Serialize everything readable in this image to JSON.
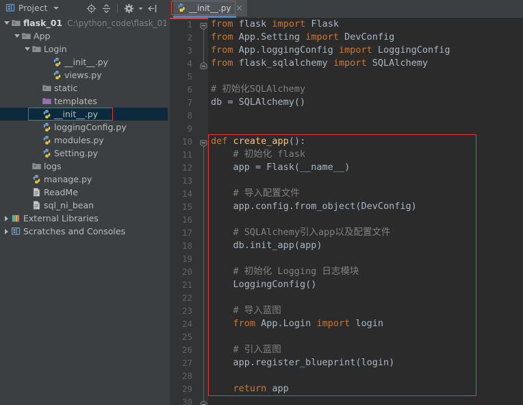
{
  "window": {
    "background": "#3c3f41",
    "editor_background": "#2b2b2b",
    "accent": "#4a88c7",
    "highlight_box_color": "#e83b2f",
    "selection_color": "#0d293e"
  },
  "toolbar": {
    "project_label": "Project",
    "project_icon": "project-panel-icon",
    "dropdown_icon": "chevron-down-icon",
    "buttons": [
      {
        "name": "locate-in-tree-icon",
        "title": "Select Opened File"
      },
      {
        "name": "collapse-all-icon",
        "title": "Collapse All"
      },
      {
        "name": "settings-gear-icon",
        "title": "Settings"
      },
      {
        "name": "hide-panel-icon",
        "title": "Hide"
      }
    ]
  },
  "tabs": [
    {
      "label": "__init__.py",
      "icon": "python-file-icon",
      "close_icon": "close-icon",
      "active": true,
      "highlighted": true
    }
  ],
  "sidebar": {
    "items": [
      {
        "indent": 0,
        "arrow": "down",
        "icon": "folder-module-icon",
        "label": "flask_01",
        "path": "C:\\python_code\\flask_01",
        "bold": true,
        "selected": false
      },
      {
        "indent": 1,
        "arrow": "down",
        "icon": "folder-source-icon",
        "label": "App",
        "path": "",
        "bold": false,
        "selected": false
      },
      {
        "indent": 2,
        "arrow": "down",
        "icon": "folder-source-icon",
        "label": "Login",
        "path": "",
        "bold": false,
        "selected": false
      },
      {
        "indent": 4,
        "arrow": "none",
        "icon": "python-file-icon",
        "label": "__init__.py",
        "path": "",
        "bold": false,
        "selected": false
      },
      {
        "indent": 4,
        "arrow": "none",
        "icon": "python-file-icon",
        "label": "views.py",
        "path": "",
        "bold": false,
        "selected": false
      },
      {
        "indent": 3,
        "arrow": "none",
        "icon": "folder-source-icon",
        "label": "static",
        "path": "",
        "bold": false,
        "selected": false
      },
      {
        "indent": 3,
        "arrow": "none",
        "icon": "folder-template-icon",
        "label": "templates",
        "path": "",
        "bold": false,
        "selected": false
      },
      {
        "indent": 3,
        "arrow": "none",
        "icon": "python-file-icon",
        "label": "__init__.py",
        "path": "",
        "bold": false,
        "selected": true
      },
      {
        "indent": 3,
        "arrow": "none",
        "icon": "python-file-icon",
        "label": "loggingConfig.py",
        "path": "",
        "bold": false,
        "selected": false
      },
      {
        "indent": 3,
        "arrow": "none",
        "icon": "python-file-icon",
        "label": "modules.py",
        "path": "",
        "bold": false,
        "selected": false
      },
      {
        "indent": 3,
        "arrow": "none",
        "icon": "python-file-icon",
        "label": "Setting.py",
        "path": "",
        "bold": false,
        "selected": false
      },
      {
        "indent": 2,
        "arrow": "none",
        "icon": "folder-source-icon",
        "label": "logs",
        "path": "",
        "bold": false,
        "selected": false
      },
      {
        "indent": 2,
        "arrow": "none",
        "icon": "python-file-icon",
        "label": "manage.py",
        "path": "",
        "bold": false,
        "selected": false
      },
      {
        "indent": 2,
        "arrow": "none",
        "icon": "text-file-icon",
        "label": "ReadMe",
        "path": "",
        "bold": false,
        "selected": false
      },
      {
        "indent": 2,
        "arrow": "none",
        "icon": "text-file-icon",
        "label": "sql_ni_bean",
        "path": "",
        "bold": false,
        "selected": false
      },
      {
        "indent": 0,
        "arrow": "right",
        "icon": "external-libraries-icon",
        "label": "External Libraries",
        "path": "",
        "bold": false,
        "selected": false
      },
      {
        "indent": 0,
        "arrow": "right",
        "icon": "scratches-icon",
        "label": "Scratches and Consoles",
        "path": "",
        "bold": false,
        "selected": false
      }
    ]
  },
  "editor": {
    "filename": "__init__.py",
    "first_line": 1,
    "last_line": 30,
    "fold_markers": [
      {
        "line": 1,
        "type": "fold-start"
      },
      {
        "line": 4,
        "type": "fold-end"
      },
      {
        "line": 10,
        "type": "fold-start"
      },
      {
        "line": 29,
        "type": "fold-end"
      }
    ],
    "lines": [
      {
        "n": 1,
        "tokens": [
          {
            "t": "from",
            "c": "kw"
          },
          {
            "t": " flask ",
            "c": "id"
          },
          {
            "t": "import",
            "c": "kw"
          },
          {
            "t": " Flask",
            "c": "id"
          }
        ]
      },
      {
        "n": 2,
        "tokens": [
          {
            "t": "from",
            "c": "kw"
          },
          {
            "t": " App.Setting ",
            "c": "id"
          },
          {
            "t": "import",
            "c": "kw"
          },
          {
            "t": " DevConfig",
            "c": "id"
          }
        ]
      },
      {
        "n": 3,
        "tokens": [
          {
            "t": "from",
            "c": "kw"
          },
          {
            "t": " App.loggingConfig ",
            "c": "id"
          },
          {
            "t": "import",
            "c": "kw"
          },
          {
            "t": " LoggingConfig",
            "c": "id"
          }
        ]
      },
      {
        "n": 4,
        "tokens": [
          {
            "t": "from",
            "c": "kw"
          },
          {
            "t": " flask_sqlalchemy ",
            "c": "id"
          },
          {
            "t": "import",
            "c": "kw"
          },
          {
            "t": " SQLAlchemy",
            "c": "id"
          }
        ]
      },
      {
        "n": 5,
        "tokens": []
      },
      {
        "n": 6,
        "tokens": [
          {
            "t": "# 初始化SQLAlchemy",
            "c": "cm"
          }
        ]
      },
      {
        "n": 7,
        "tokens": [
          {
            "t": "db = SQLAlchemy()",
            "c": "id"
          }
        ]
      },
      {
        "n": 8,
        "tokens": []
      },
      {
        "n": 9,
        "tokens": []
      },
      {
        "n": 10,
        "tokens": [
          {
            "t": "def",
            "c": "kw"
          },
          {
            "t": " ",
            "c": "id"
          },
          {
            "t": "create_app",
            "c": "fn"
          },
          {
            "t": "():",
            "c": "id"
          }
        ]
      },
      {
        "n": 11,
        "tokens": [
          {
            "t": "    # 初始化 flask",
            "c": "cm"
          }
        ]
      },
      {
        "n": 12,
        "tokens": [
          {
            "t": "    app = Flask(__name__)",
            "c": "id"
          }
        ]
      },
      {
        "n": 13,
        "tokens": []
      },
      {
        "n": 14,
        "tokens": [
          {
            "t": "    # 导入配置文件",
            "c": "cm"
          }
        ]
      },
      {
        "n": 15,
        "tokens": [
          {
            "t": "    app.config.from_object(DevConfig)",
            "c": "id"
          }
        ]
      },
      {
        "n": 16,
        "tokens": []
      },
      {
        "n": 17,
        "tokens": [
          {
            "t": "    # SQLAlchemy引入app以及配置文件",
            "c": "cm"
          }
        ]
      },
      {
        "n": 18,
        "tokens": [
          {
            "t": "    db.init_app(app)",
            "c": "id"
          }
        ]
      },
      {
        "n": 19,
        "tokens": []
      },
      {
        "n": 20,
        "tokens": [
          {
            "t": "    # 初始化 Logging 日志模块",
            "c": "cm"
          }
        ]
      },
      {
        "n": 21,
        "tokens": [
          {
            "t": "    LoggingConfig()",
            "c": "id"
          }
        ]
      },
      {
        "n": 22,
        "tokens": []
      },
      {
        "n": 23,
        "tokens": [
          {
            "t": "    # 导入蓝图",
            "c": "cm"
          }
        ]
      },
      {
        "n": 24,
        "tokens": [
          {
            "t": "    ",
            "c": "id"
          },
          {
            "t": "from",
            "c": "kw"
          },
          {
            "t": " App.Login ",
            "c": "id"
          },
          {
            "t": "import",
            "c": "kw"
          },
          {
            "t": " login",
            "c": "id"
          }
        ]
      },
      {
        "n": 25,
        "tokens": []
      },
      {
        "n": 26,
        "tokens": [
          {
            "t": "    # 引入蓝图",
            "c": "cm"
          }
        ]
      },
      {
        "n": 27,
        "tokens": [
          {
            "t": "    app.register_blueprint(login)",
            "c": "id"
          }
        ]
      },
      {
        "n": 28,
        "tokens": []
      },
      {
        "n": 29,
        "tokens": [
          {
            "t": "    ",
            "c": "id"
          },
          {
            "t": "return",
            "c": "kw"
          },
          {
            "t": " app",
            "c": "id"
          }
        ]
      },
      {
        "n": 30,
        "tokens": []
      }
    ],
    "syntax_colors": {
      "keyword": "#cc7832",
      "identifier": "#a9b7c6",
      "function": "#ffc66d",
      "comment": "#808080"
    }
  },
  "annotations": [
    {
      "name": "tab-highlight",
      "shape": "rect",
      "color": "#e83b2f"
    },
    {
      "name": "sidebar-file-highlight",
      "shape": "rect",
      "color": "#e83b2f"
    },
    {
      "name": "code-block-highlight",
      "shape": "rect",
      "color": "#e83b2f"
    }
  ]
}
